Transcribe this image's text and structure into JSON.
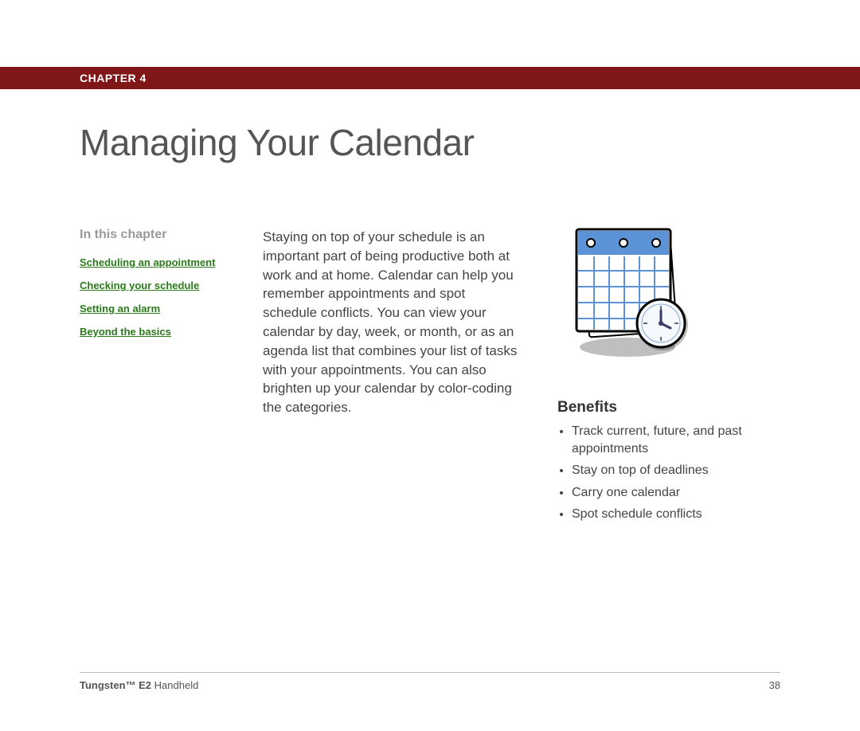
{
  "header": {
    "chapter_label": "CHAPTER 4"
  },
  "title": "Managing Your Calendar",
  "sidebar": {
    "heading": "In this chapter",
    "links": [
      "Scheduling an appointment",
      "Checking your schedule",
      "Setting an alarm",
      "Beyond the basics"
    ]
  },
  "body_text": "Staying on top of your schedule is an important part of being productive both at work and at home. Calendar can help you remember appointments and spot schedule conflicts. You can view your calendar by day, week, or month, or as an agenda list that combines your list of tasks with your appointments. You can also brighten up your calendar by color-coding the categories.",
  "benefits": {
    "heading": "Benefits",
    "items": [
      "Track current, future, and past appointments",
      "Stay on top of deadlines",
      "Carry one calendar",
      "Spot schedule conflicts"
    ]
  },
  "footer": {
    "product_bold": "Tungsten™ E2",
    "product_rest": " Handheld",
    "page_number": "38"
  }
}
